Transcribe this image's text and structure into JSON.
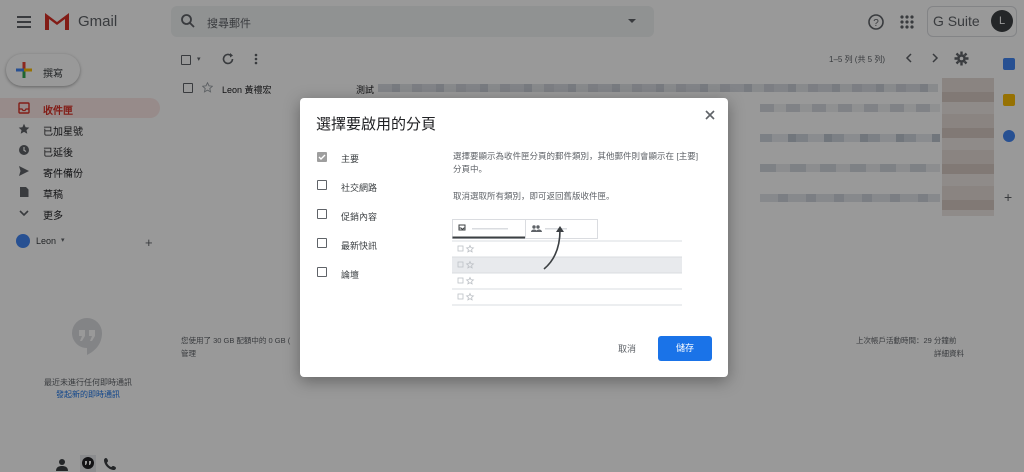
{
  "app": {
    "name": "Gmail",
    "brand": "G Suite",
    "avatar_letter": "L"
  },
  "search": {
    "placeholder": "搜尋郵件"
  },
  "sidebar": {
    "compose_label": "撰寫",
    "items": [
      {
        "label": "收件匣",
        "icon": "inbox-icon",
        "active": true
      },
      {
        "label": "已加星號",
        "icon": "star-icon"
      },
      {
        "label": "已延後",
        "icon": "clock-icon"
      },
      {
        "label": "寄件備份",
        "icon": "send-icon"
      },
      {
        "label": "草稿",
        "icon": "draft-icon"
      },
      {
        "label": "更多",
        "icon": "chevron-down-icon"
      }
    ],
    "account_name": "Leon",
    "hangouts_text": "最近未進行任何即時通訊",
    "hangouts_link": "發起新的即時通訊"
  },
  "toolbar": {
    "paging": "1–5 列 (共 5 列)"
  },
  "message": {
    "sender": "Leon 黃禮宏",
    "subject": "測試"
  },
  "footer": {
    "storage": "您使用了 30 GB 配額中的 0 GB (",
    "manage": "管理",
    "last_activity": "上次帳戶活動時間：29 分鐘前",
    "details": "詳細資料"
  },
  "dialog": {
    "title": "選擇要啟用的分頁",
    "options": [
      {
        "label": "主要",
        "checked": true
      },
      {
        "label": "社交網路",
        "checked": false
      },
      {
        "label": "促銷內容",
        "checked": false
      },
      {
        "label": "最新快訊",
        "checked": false
      },
      {
        "label": "論壇",
        "checked": false
      }
    ],
    "description": "選擇要顯示為收件匣分頁的郵件類別，其他郵件則會顯示在 [主要] 分頁中。",
    "description2": "取消選取所有類別，即可返回舊版收件匣。",
    "cancel_label": "取消",
    "save_label": "儲存"
  },
  "colors": {
    "accent": "#1a73e8",
    "gmail_red": "#d93025",
    "overlay": "rgba(0,0,0,0.4)"
  }
}
